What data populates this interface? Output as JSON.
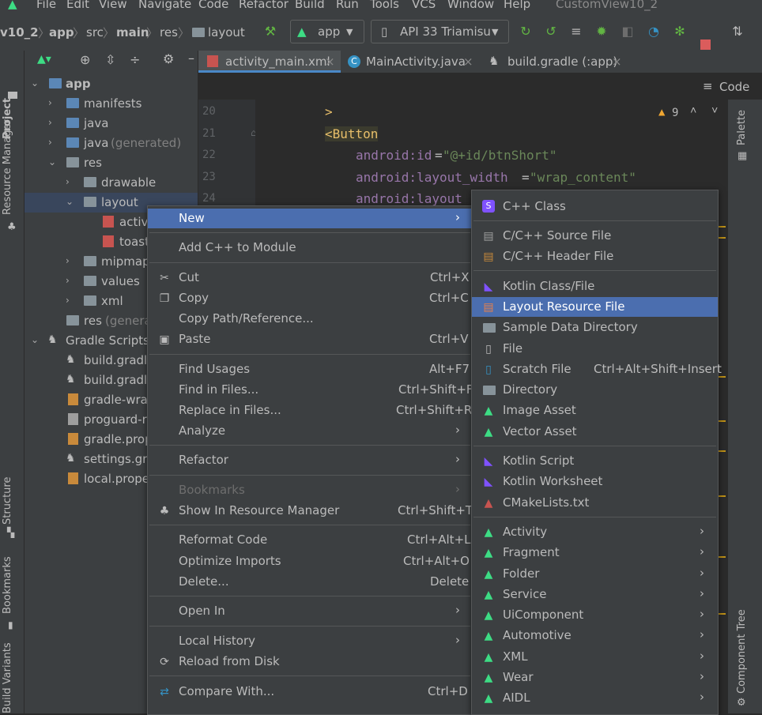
{
  "menubar": {
    "items": [
      "File",
      "Edit",
      "View",
      "Navigate",
      "Code",
      "Refactor",
      "Build",
      "Run",
      "Tools",
      "VCS",
      "Window",
      "Help"
    ],
    "project_title": "CustomView10_2"
  },
  "toolbar": {
    "breadcrumbs": [
      "v10_2",
      "app",
      "src",
      "main",
      "res",
      "layout"
    ],
    "run_config": "app",
    "device": "API 33 Triamisu"
  },
  "side_tabs": {
    "project": "Project",
    "resource_manager": "Resource Manager",
    "structure": "Structure",
    "bookmarks": "Bookmarks",
    "build_variants": "Build Variants",
    "palette": "Palette",
    "component_tree": "Component Tree"
  },
  "tree": [
    {
      "label": "app",
      "depth": 0
    },
    {
      "label": "manifests",
      "depth": 1
    },
    {
      "label": "java",
      "depth": 1
    },
    {
      "label": "java",
      "suffix": "(generated)",
      "depth": 1
    },
    {
      "label": "res",
      "depth": 1
    },
    {
      "label": "drawable",
      "depth": 2
    },
    {
      "label": "layout",
      "depth": 2
    },
    {
      "label": "activi",
      "depth": 3
    },
    {
      "label": "toast",
      "depth": 3
    },
    {
      "label": "mipmap",
      "depth": 2
    },
    {
      "label": "values",
      "depth": 2
    },
    {
      "label": "xml",
      "depth": 2
    },
    {
      "label": "res",
      "suffix": "(generat",
      "depth": 1
    },
    {
      "label": "Gradle Scripts",
      "depth": 0
    },
    {
      "label": "build.gradle",
      "depth": 1
    },
    {
      "label": "build.gradle",
      "depth": 1
    },
    {
      "label": "gradle-wrap",
      "depth": 1
    },
    {
      "label": "proguard-ru",
      "depth": 1
    },
    {
      "label": "gradle.prop",
      "depth": 1
    },
    {
      "label": "settings.gra",
      "depth": 1
    },
    {
      "label": "local.proper",
      "depth": 1
    }
  ],
  "tabs": [
    "activity_main.xml",
    "MainActivity.java",
    "build.gradle (:app)"
  ],
  "editor": {
    "mode_label": "Code",
    "warning_count": "9",
    "line_numbers": [
      "20",
      "21",
      "22",
      "23",
      "24"
    ],
    "lines": [
      {
        "text": ">"
      },
      {
        "text": "<Button"
      },
      {
        "attr": "android:id",
        "value": "\"@+id/btnShort\""
      },
      {
        "attr": "android:layout_width",
        "value": "\"wrap_content\""
      },
      {
        "attr": "android:layout",
        "value": ""
      }
    ]
  },
  "context_menu": {
    "items": [
      {
        "label": "New",
        "shortcut": "",
        "submenu": true,
        "highlight": true
      },
      {
        "label": "Add C++ to Module",
        "shortcut": ""
      },
      {
        "label": "Cut",
        "shortcut": "Ctrl+X",
        "icon": "cut-icon"
      },
      {
        "label": "Copy",
        "shortcut": "Ctrl+C",
        "icon": "copy-icon"
      },
      {
        "label": "Copy Path/Reference...",
        "shortcut": ""
      },
      {
        "label": "Paste",
        "shortcut": "Ctrl+V",
        "icon": "paste-icon"
      },
      {
        "label": "Find Usages",
        "shortcut": "Alt+F7"
      },
      {
        "label": "Find in Files...",
        "shortcut": "Ctrl+Shift+F"
      },
      {
        "label": "Replace in Files...",
        "shortcut": "Ctrl+Shift+R"
      },
      {
        "label": "Analyze",
        "shortcut": "",
        "submenu": true
      },
      {
        "label": "Refactor",
        "shortcut": "",
        "submenu": true
      },
      {
        "label": "Bookmarks",
        "shortcut": "",
        "submenu": true,
        "disabled": true
      },
      {
        "label": "Show In Resource Manager",
        "shortcut": "Ctrl+Shift+T",
        "icon": "resource-manager-icon"
      },
      {
        "label": "Reformat Code",
        "shortcut": "Ctrl+Alt+L"
      },
      {
        "label": "Optimize Imports",
        "shortcut": "Ctrl+Alt+O"
      },
      {
        "label": "Delete...",
        "shortcut": "Delete"
      },
      {
        "label": "Open In",
        "shortcut": "",
        "submenu": true
      },
      {
        "label": "Local History",
        "shortcut": "",
        "submenu": true
      },
      {
        "label": "Reload from Disk",
        "shortcut": "",
        "icon": "reload-icon"
      },
      {
        "label": "Compare With...",
        "shortcut": "Ctrl+D",
        "icon": "compare-icon"
      }
    ]
  },
  "new_submenu": {
    "items": [
      {
        "label": "C++ Class",
        "shortcut": "",
        "icon": "cpp-class-icon"
      },
      {
        "label": "C/C++ Source File",
        "shortcut": "",
        "icon": "cpp-source-icon"
      },
      {
        "label": "C/C++ Header File",
        "shortcut": "",
        "icon": "cpp-header-icon"
      },
      {
        "label": "Kotlin Class/File",
        "shortcut": "",
        "icon": "kotlin-file-icon"
      },
      {
        "label": "Layout Resource File",
        "shortcut": "",
        "icon": "layout-file-icon",
        "highlight": true
      },
      {
        "label": "Sample Data Directory",
        "shortcut": "",
        "icon": "folder-icon"
      },
      {
        "label": "File",
        "shortcut": "",
        "icon": "file-icon"
      },
      {
        "label": "Scratch File",
        "shortcut": "Ctrl+Alt+Shift+Insert",
        "icon": "scratch-file-icon"
      },
      {
        "label": "Directory",
        "shortcut": "",
        "icon": "folder-icon"
      },
      {
        "label": "Image Asset",
        "shortcut": "",
        "icon": "android-icon"
      },
      {
        "label": "Vector Asset",
        "shortcut": "",
        "icon": "android-icon"
      },
      {
        "label": "Kotlin Script",
        "shortcut": "",
        "icon": "kotlin-script-icon"
      },
      {
        "label": "Kotlin Worksheet",
        "shortcut": "",
        "icon": "kotlin-worksheet-icon"
      },
      {
        "label": "CMakeLists.txt",
        "shortcut": "",
        "icon": "cmake-icon"
      },
      {
        "label": "Activity",
        "shortcut": "",
        "submenu": true,
        "icon": "android-icon"
      },
      {
        "label": "Fragment",
        "shortcut": "",
        "submenu": true,
        "icon": "android-icon"
      },
      {
        "label": "Folder",
        "shortcut": "",
        "submenu": true,
        "icon": "android-icon"
      },
      {
        "label": "Service",
        "shortcut": "",
        "submenu": true,
        "icon": "android-icon"
      },
      {
        "label": "UiComponent",
        "shortcut": "",
        "submenu": true,
        "icon": "android-icon"
      },
      {
        "label": "Automotive",
        "shortcut": "",
        "submenu": true,
        "icon": "android-icon"
      },
      {
        "label": "XML",
        "shortcut": "",
        "submenu": true,
        "icon": "android-icon"
      },
      {
        "label": "Wear",
        "shortcut": "",
        "submenu": true,
        "icon": "android-icon"
      },
      {
        "label": "AIDL",
        "shortcut": "",
        "submenu": true,
        "icon": "android-icon"
      }
    ]
  },
  "colors": {
    "highlight": "#4b6eaf",
    "android_green": "#3ddc84",
    "kotlin_purple": "#7f52ff",
    "warning": "#f0a732"
  }
}
